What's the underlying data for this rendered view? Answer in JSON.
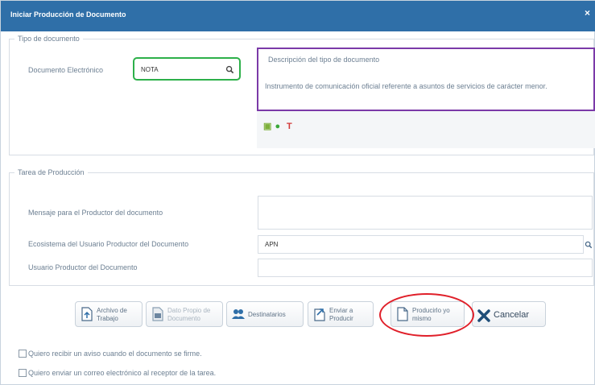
{
  "dialog": {
    "title": "Iniciar Producción de Documento",
    "close_glyph": "×"
  },
  "tipo_documento": {
    "legend": "Tipo de documento",
    "label": "Documento Electrónico",
    "value": "NOTA",
    "description_legend": "Descripción del tipo de documento",
    "description_text": "Instrumento de comunicación oficial referente a asuntos de servicios de carácter menor."
  },
  "tarea_produccion": {
    "legend": "Tarea de Producción",
    "mensaje_label": "Mensaje para el Productor del documento",
    "mensaje_value": "",
    "ecosistema_label": "Ecosistema del Usuario Productor del Documento",
    "ecosistema_value": "APN",
    "usuario_label": "Usuario Productor del Documento",
    "usuario_value": ""
  },
  "actions": {
    "archivo_trabajo": "Archivo de Trabajo",
    "dato_propio": "Dato Propio de Documento",
    "destinatarios": "Destinatarios",
    "enviar_producir": "Enviar a Producir",
    "producirlo_yo": "Producirlo yo mismo",
    "cancelar": "Cancelar"
  },
  "checkboxes": {
    "aviso_firma": "Quiero recibir un aviso cuando el documento se firme.",
    "correo_receptor": "Quiero enviar un correo electrónico al receptor de la tarea."
  },
  "colors": {
    "title_bar": "#2f6fa8",
    "highlight_green": "#2db04a",
    "highlight_purple": "#7b3aa8",
    "highlight_red": "#e0202a"
  }
}
